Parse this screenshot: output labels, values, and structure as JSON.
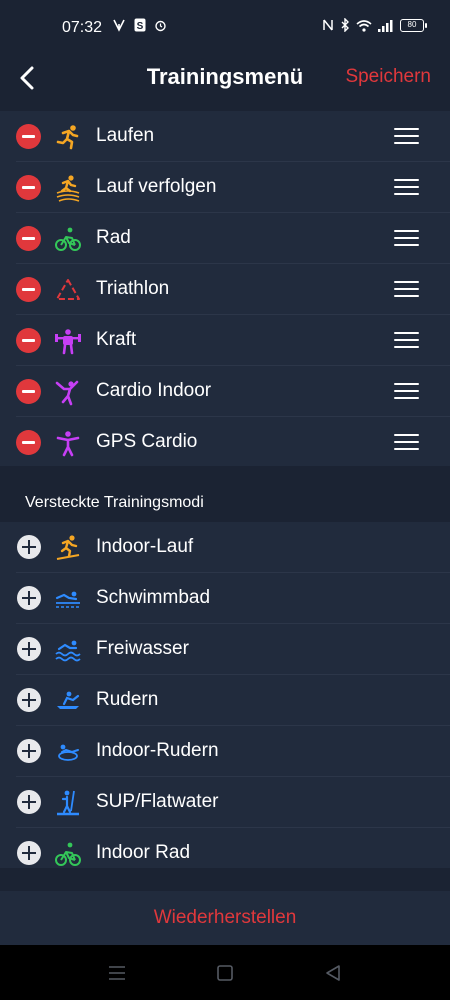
{
  "status_bar": {
    "time": "07:32",
    "battery": "80"
  },
  "header": {
    "title": "Trainingsmenü",
    "save_label": "Speichern"
  },
  "active_items": [
    {
      "label": "Laufen",
      "icon": "running-icon",
      "color": "#f5a623"
    },
    {
      "label": "Lauf verfolgen",
      "icon": "track-run-icon",
      "color": "#f5a623"
    },
    {
      "label": "Rad",
      "icon": "cycling-icon",
      "color": "#34c759"
    },
    {
      "label": "Triathlon",
      "icon": "triathlon-icon",
      "color": "#e0383c"
    },
    {
      "label": "Kraft",
      "icon": "strength-icon",
      "color": "#c63ff5"
    },
    {
      "label": "Cardio Indoor",
      "icon": "cardio-indoor-icon",
      "color": "#c63ff5"
    },
    {
      "label": "GPS Cardio",
      "icon": "gps-cardio-icon",
      "color": "#c63ff5"
    }
  ],
  "hidden_section_title": "Versteckte Trainingsmodi",
  "hidden_items": [
    {
      "label": "Indoor-Lauf",
      "icon": "indoor-run-icon",
      "color": "#f5a623"
    },
    {
      "label": "Schwimmbad",
      "icon": "pool-swim-icon",
      "color": "#2e8bff"
    },
    {
      "label": "Freiwasser",
      "icon": "open-water-icon",
      "color": "#2e8bff"
    },
    {
      "label": "Rudern",
      "icon": "rowing-icon",
      "color": "#2e8bff"
    },
    {
      "label": "Indoor-Rudern",
      "icon": "indoor-rowing-icon",
      "color": "#2e8bff"
    },
    {
      "label": "SUP/Flatwater",
      "icon": "sup-icon",
      "color": "#2e8bff"
    },
    {
      "label": "Indoor Rad",
      "icon": "indoor-cycling-icon",
      "color": "#34c759"
    }
  ],
  "footer": {
    "reset_label": "Wiederherstellen"
  },
  "colors": {
    "accent": "#e0383c",
    "background": "#1b2333",
    "surface": "#212b3d"
  }
}
